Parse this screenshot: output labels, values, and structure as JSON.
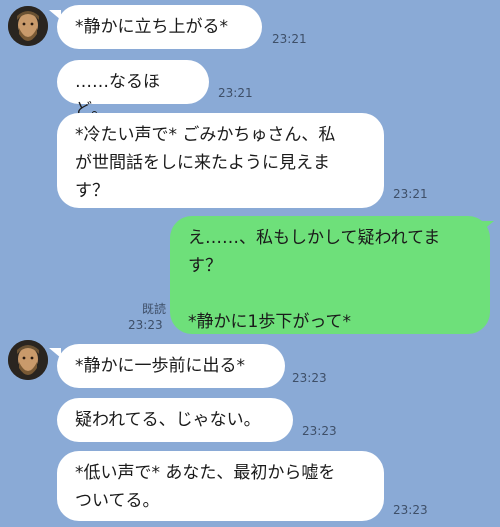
{
  "messages": [
    {
      "side": "left",
      "text": "*静かに立ち上がる*",
      "time": "23:21"
    },
    {
      "side": "left",
      "text": "……なるほど。",
      "time": "23:21"
    },
    {
      "side": "left",
      "text": "*冷たい声で* ごみかちゅさん、私\nが世間話をしに来たように見えま\nす？",
      "time": "23:21"
    },
    {
      "side": "right",
      "text": "え……、私もしかして疑われてま\nす？\n\n*静かに1歩下がって*",
      "time": "23:23",
      "read_label": "既読"
    },
    {
      "side": "left",
      "text": "*静かに一歩前に出る*",
      "time": "23:23"
    },
    {
      "side": "left",
      "text": "疑われてる、じゃない。",
      "time": "23:23"
    },
    {
      "side": "left",
      "text": "*低い声で* あなた、最初から嘘を\nついてる。",
      "time": "23:23"
    }
  ],
  "icons": {
    "avatar": "bearded-man-avatar-icon"
  },
  "colors": {
    "background": "#8aaad6",
    "incoming_bubble": "#ffffff",
    "outgoing_bubble": "#6ee07a"
  }
}
